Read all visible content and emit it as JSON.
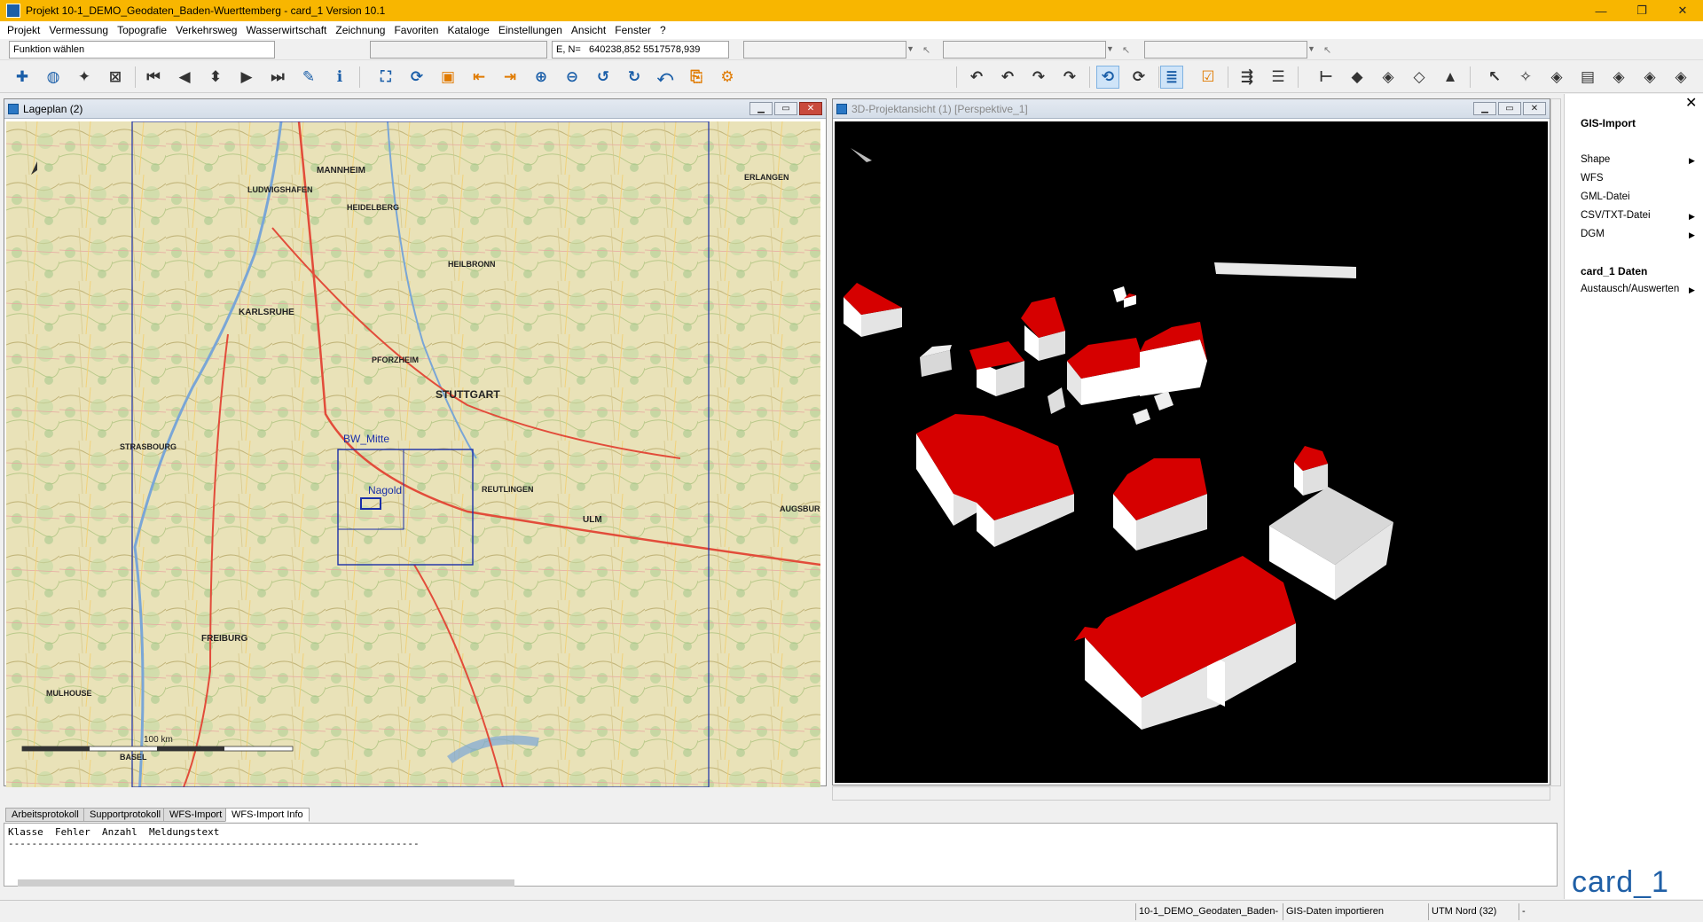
{
  "window": {
    "title": "Projekt 10-1_DEMO_Geodaten_Baden-Wuerttemberg - card_1 Version 10.1",
    "minimize": "—",
    "maximize": "❐",
    "close": "✕"
  },
  "menu": [
    "Projekt",
    "Vermessung",
    "Topografie",
    "Verkehrsweg",
    "Wasserwirtschaft",
    "Zeichnung",
    "Favoriten",
    "Kataloge",
    "Einstellungen",
    "Ansicht",
    "Fenster",
    "?"
  ],
  "fields": {
    "function": "Funktion wählen",
    "coords_label": "E, N=",
    "coords_value": "640238,852  5517578,939"
  },
  "toolbar": {
    "icons": [
      "add-icon",
      "globe-icon",
      "pin-icon",
      "table-close-icon",
      "first-icon",
      "prev-icon",
      "updown-icon",
      "next-icon",
      "last-icon",
      "pen-icon",
      "info-icon",
      "zoom-extent-icon",
      "refresh-icon",
      "window-icon",
      "pan-left-icon",
      "pan-right-icon",
      "zoom-in-icon",
      "zoom-out-icon",
      "rotate-left-icon",
      "rotate-right-icon",
      "undo-view-icon",
      "export-icon",
      "settings-icon",
      "undo-icon",
      "undo2-icon",
      "redo-icon",
      "redo2-icon",
      "rotate3d-icon",
      "rotate3d2-icon",
      "list-icon",
      "check-icon",
      "indent-icon",
      "lines-icon",
      "tree-icon",
      "tag-icon",
      "diamond-icon",
      "diamond2-icon",
      "terrain-icon",
      "cursor-icon",
      "wand-icon",
      "layer1-icon",
      "layer2-icon",
      "layer3-icon",
      "layer4-icon",
      "layer5-icon"
    ]
  },
  "lageplan": {
    "title": "Lageplan (2)",
    "labels": {
      "mannheim": "MANNHEIM",
      "heidelberg": "HEIDELBERG",
      "karlsruhe": "KARLSRUHE",
      "stuttgart": "STUTTGART",
      "pforzheim": "PFORZHEIM",
      "strasbourg": "STRASBOURG",
      "freiburg": "FREIBURG",
      "ulm": "ULM",
      "augsburg": "AUGSBURG",
      "erlangen": "ERLANGEN",
      "heilbronn": "HEILBRONN",
      "ludwigshafen": "LUDWIGSHAFEN",
      "basel": "BASEL",
      "mulhouse": "MULHOUSE",
      "bw_mitte": "BW_Mitte",
      "nagold": "Nagold",
      "reutlingen": "REUTLINGEN",
      "scale": "100 km"
    }
  },
  "view3d": {
    "title": "3D-Projektansicht (1) [Perspektive_1]"
  },
  "gis_panel": {
    "close": "✕",
    "header1": "GIS-Import",
    "items": [
      "Shape",
      "WFS",
      "GML-Datei",
      "CSV/TXT-Datei",
      "DGM"
    ],
    "header2": "card_1 Daten",
    "items2": [
      "Austausch/Auswerten"
    ]
  },
  "log": {
    "tabs": [
      "Arbeitsprotokoll",
      "Supportprotokoll",
      "WFS-Import",
      "WFS-Import Info"
    ],
    "header": "Klasse  Fehler  Anzahl  Meldungstext",
    "divider": "----------------------------------------------------------------------"
  },
  "status": {
    "project": "10-1_DEMO_Geodaten_Baden-",
    "action": "GIS-Daten importieren",
    "crs": "UTM Nord (32)",
    "extra": "-"
  },
  "logo": "card_1"
}
